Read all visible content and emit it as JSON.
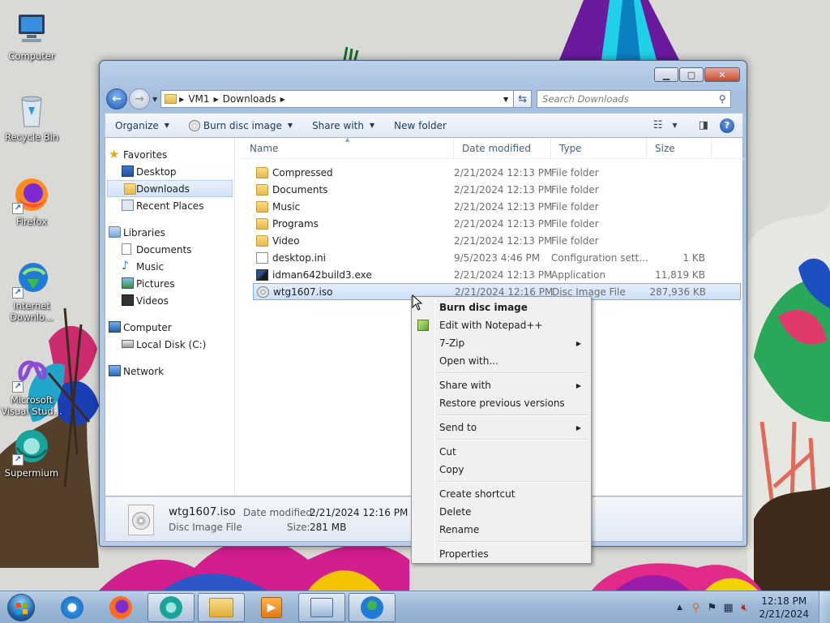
{
  "desktop": {
    "icons": [
      {
        "label": "Computer"
      },
      {
        "label": "Recycle Bin"
      },
      {
        "label": "Firefox"
      },
      {
        "label": "Internet Downlo..."
      },
      {
        "label": "Microsoft Visual Stud..."
      },
      {
        "label": "Supermium"
      }
    ]
  },
  "window": {
    "address": {
      "crumbs": [
        "VM1",
        "Downloads"
      ]
    },
    "search": {
      "placeholder": "Search Downloads"
    },
    "toolbar": {
      "organize": "Organize",
      "burn": "Burn disc image",
      "share": "Share with",
      "new_folder": "New folder"
    },
    "nav": {
      "favorites": "Favorites",
      "favorites_items": [
        "Desktop",
        "Downloads",
        "Recent Places"
      ],
      "libraries": "Libraries",
      "libraries_items": [
        "Documents",
        "Music",
        "Pictures",
        "Videos"
      ],
      "computer": "Computer",
      "computer_items": [
        "Local Disk (C:)"
      ],
      "network": "Network"
    },
    "columns": {
      "name": "Name",
      "date": "Date modified",
      "type": "Type",
      "size": "Size"
    },
    "files": [
      {
        "name": "Compressed",
        "date": "2/21/2024 12:13 PM",
        "type": "File folder",
        "size": ""
      },
      {
        "name": "Documents",
        "date": "2/21/2024 12:13 PM",
        "type": "File folder",
        "size": ""
      },
      {
        "name": "Music",
        "date": "2/21/2024 12:13 PM",
        "type": "File folder",
        "size": ""
      },
      {
        "name": "Programs",
        "date": "2/21/2024 12:13 PM",
        "type": "File folder",
        "size": ""
      },
      {
        "name": "Video",
        "date": "2/21/2024 12:13 PM",
        "type": "File folder",
        "size": ""
      },
      {
        "name": "desktop.ini",
        "date": "9/5/2023 4:46 PM",
        "type": "Configuration sett...",
        "size": "1 KB"
      },
      {
        "name": "idman642build3.exe",
        "date": "2/21/2024 12:13 PM",
        "type": "Application",
        "size": "11,819 KB"
      },
      {
        "name": "wtg1607.iso",
        "date": "2/21/2024 12:16 PM",
        "type": "Disc Image File",
        "size": "287,936 KB"
      }
    ],
    "details": {
      "name": "wtg1607.iso",
      "file_type": "Disc Image File",
      "date_label": "Date modified:",
      "date_value": "2/21/2024 12:16 PM",
      "size_label": "Size:",
      "size_value": "281 MB"
    }
  },
  "context_menu": {
    "burn": "Burn disc image",
    "notepad": "Edit with Notepad++",
    "zip": "7-Zip",
    "open_with": "Open with...",
    "share_with": "Share with",
    "restore": "Restore previous versions",
    "send_to": "Send to",
    "cut": "Cut",
    "copy": "Copy",
    "create_shortcut": "Create shortcut",
    "delete": "Delete",
    "rename": "Rename",
    "properties": "Properties"
  },
  "taskbar": {
    "clock_time": "12:18 PM",
    "clock_date": "2/21/2024"
  }
}
